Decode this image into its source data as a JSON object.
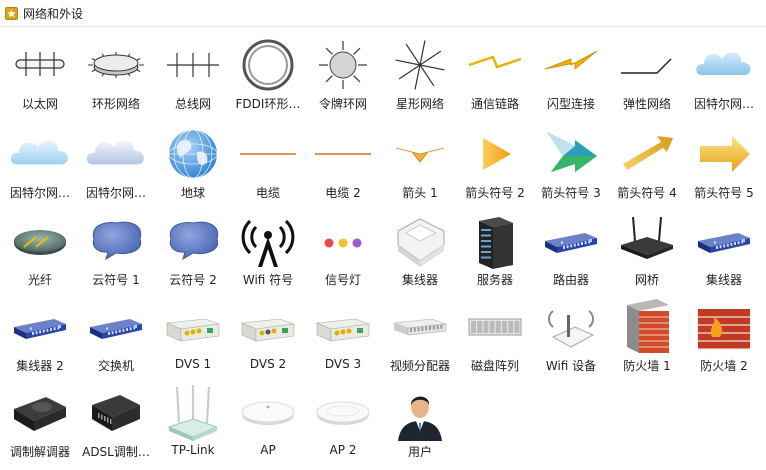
{
  "panel": {
    "title": "网络和外设"
  },
  "items": [
    {
      "label": "以太网",
      "icon": "ethernet-icon"
    },
    {
      "label": "环形网络",
      "icon": "ring-network-icon"
    },
    {
      "label": "总线网",
      "icon": "bus-network-icon"
    },
    {
      "label": "FDDI环形…",
      "icon": "fddi-ring-icon"
    },
    {
      "label": "令牌环网",
      "icon": "token-ring-icon"
    },
    {
      "label": "星形网络",
      "icon": "star-network-icon"
    },
    {
      "label": "通信链路",
      "icon": "comm-link-icon"
    },
    {
      "label": "闪型连接",
      "icon": "lightning-link-icon"
    },
    {
      "label": "弹性网络",
      "icon": "elastic-network-icon"
    },
    {
      "label": "因特尔网…",
      "icon": "internet-cloud-icon"
    },
    {
      "label": "因特尔网…",
      "icon": "internet-cloud-2-icon"
    },
    {
      "label": "因特尔网…",
      "icon": "internet-cloud-3-icon"
    },
    {
      "label": "地球",
      "icon": "globe-icon"
    },
    {
      "label": "电缆",
      "icon": "cable-icon"
    },
    {
      "label": "电缆 2",
      "icon": "cable-2-icon"
    },
    {
      "label": "箭头 1",
      "icon": "arrow-1-icon"
    },
    {
      "label": "箭头符号 2",
      "icon": "arrow-symbol-2-icon"
    },
    {
      "label": "箭头符号 3",
      "icon": "arrow-symbol-3-icon"
    },
    {
      "label": "箭头符号 4",
      "icon": "arrow-symbol-4-icon"
    },
    {
      "label": "箭头符号 5",
      "icon": "arrow-symbol-5-icon"
    },
    {
      "label": "光纤",
      "icon": "fiber-icon"
    },
    {
      "label": "云符号 1",
      "icon": "cloud-symbol-1-icon"
    },
    {
      "label": "云符号 2",
      "icon": "cloud-symbol-2-icon"
    },
    {
      "label": "Wifi 符号",
      "icon": "wifi-symbol-icon"
    },
    {
      "label": "信号灯",
      "icon": "signal-light-icon"
    },
    {
      "label": "集线器",
      "icon": "hub-white-icon"
    },
    {
      "label": "服务器",
      "icon": "server-icon"
    },
    {
      "label": "路由器",
      "icon": "router-icon"
    },
    {
      "label": "网桥",
      "icon": "bridge-icon"
    },
    {
      "label": "集线器",
      "icon": "hub-blue-icon"
    },
    {
      "label": "集线器 2",
      "icon": "hub-2-icon"
    },
    {
      "label": "交换机",
      "icon": "switch-icon"
    },
    {
      "label": "DVS 1",
      "icon": "dvs-1-icon"
    },
    {
      "label": "DVS 2",
      "icon": "dvs-2-icon"
    },
    {
      "label": "DVS 3",
      "icon": "dvs-3-icon"
    },
    {
      "label": "视频分配器",
      "icon": "video-splitter-icon"
    },
    {
      "label": "磁盘阵列",
      "icon": "disk-array-icon"
    },
    {
      "label": "Wifi 设备",
      "icon": "wifi-device-icon"
    },
    {
      "label": "防火墙 1",
      "icon": "firewall-1-icon"
    },
    {
      "label": "防火墙 2",
      "icon": "firewall-2-icon"
    },
    {
      "label": "调制解调器",
      "icon": "modem-icon"
    },
    {
      "label": "ADSL调制…",
      "icon": "adsl-modem-icon"
    },
    {
      "label": "TP-Link",
      "icon": "tp-link-icon"
    },
    {
      "label": "AP",
      "icon": "ap-icon"
    },
    {
      "label": "AP 2",
      "icon": "ap-2-icon"
    },
    {
      "label": "用户",
      "icon": "user-icon"
    }
  ]
}
